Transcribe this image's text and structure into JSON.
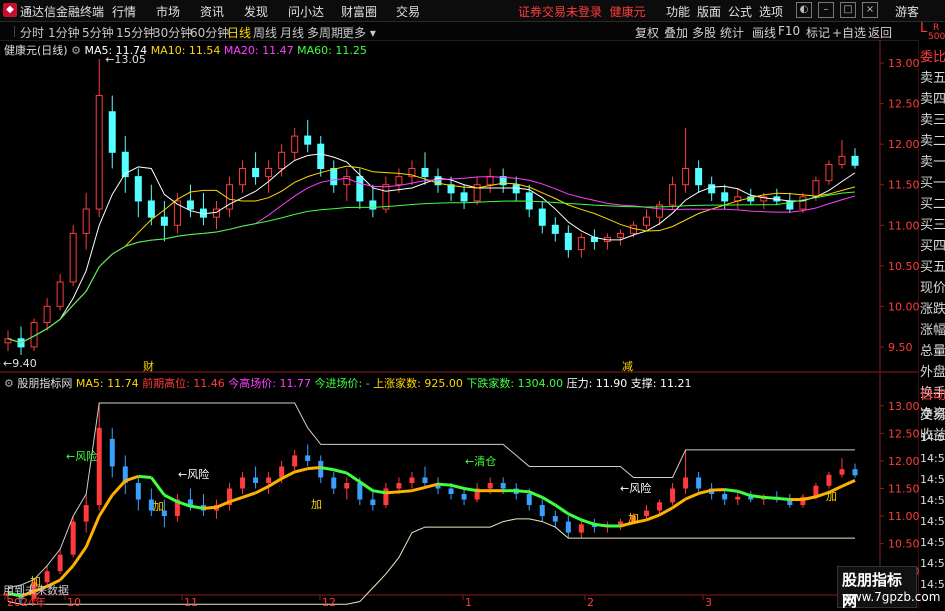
{
  "titlebar": {
    "app_name": "通达信金融终端",
    "menu": [
      "行情",
      "市场",
      "资讯",
      "发现",
      "问小达",
      "财富圈",
      "交易"
    ],
    "notice": "证券交易未登录",
    "stock_name": "健康元",
    "right_menu": [
      "功能",
      "版面",
      "公式",
      "选项"
    ],
    "guest": "游客"
  },
  "toolbar": {
    "periods": [
      "分时",
      "1分钟",
      "5分钟",
      "15分钟",
      "30分钟",
      "60分钟",
      "日线",
      "周线",
      "月线",
      "多周期",
      "更多"
    ],
    "active_period": "日线",
    "right_tools": [
      "复权",
      "叠加",
      "多股",
      "统计",
      "画线",
      "F10",
      "标记",
      "+自选",
      "返回"
    ]
  },
  "sidebar": {
    "lr_top": "L",
    "lr_r": "R",
    "lr_num": "500",
    "items": [
      "委比",
      "卖五",
      "卖四",
      "卖三",
      "卖二",
      "卖一",
      "买一",
      "买二",
      "买三",
      "买四",
      "买五",
      "现价",
      "涨跌",
      "涨幅",
      "总量",
      "外盘",
      "换手",
      "净资",
      "收益"
    ],
    "lower_items": [
      "自动",
      "交易"
    ],
    "times": [
      "14:56",
      "14:56",
      "14:56",
      "14:56",
      "14:56",
      "14:56",
      "14:56",
      "14:56"
    ]
  },
  "main_panel": {
    "title": "健康元(日线)",
    "ma": [
      {
        "label": "MA5: 11.74",
        "color": "#ffffff"
      },
      {
        "label": "MA10: 11.54",
        "color": "#ffd700"
      },
      {
        "label": "MA20: 11.47",
        "color": "#ff40ff"
      },
      {
        "label": "MA60: 11.25",
        "color": "#40ff40"
      }
    ],
    "y_ticks": [
      "13.00",
      "12.50",
      "12.00",
      "11.50",
      "11.00",
      "10.50",
      "10.00",
      "9.50"
    ],
    "high_label": "13.05",
    "low_label": "9.40",
    "markers": [
      "财",
      "减"
    ]
  },
  "sub_panel": {
    "title": "股朋指标网",
    "fields": [
      {
        "label": "MA5: 11.74",
        "color": "#ffd700"
      },
      {
        "label": "前期高位: 11.46",
        "color": "#ff3b3b"
      },
      {
        "label": "今高场价: 11.77",
        "color": "#ff40ff"
      },
      {
        "label": "今进场价: -",
        "color": "#40ff40"
      },
      {
        "label": "上涨家数: 925.00",
        "color": "#ffd700"
      },
      {
        "label": "下跌家数: 1304.00",
        "color": "#40ff40"
      },
      {
        "label": "压力: 11.90",
        "color": "#ffffff"
      },
      {
        "label": "支撑: 11.21",
        "color": "#ffffff"
      }
    ],
    "y_ticks": [
      "13.00",
      "12.50",
      "12.00",
      "11.50",
      "11.00",
      "10.50",
      "10.00"
    ],
    "annotations": [
      "风险",
      "风险",
      "清仓",
      "风险",
      "加",
      "加",
      "加",
      "加",
      "加"
    ],
    "footer": "用到未来数据"
  },
  "x_ticks": [
    "2024年",
    "10",
    "11",
    "12",
    "1",
    "2",
    "3"
  ],
  "watermark": {
    "line1": "股朋指标网",
    "line2": "www.7gpzb.com"
  },
  "chart_data": {
    "type": "candlestick",
    "title": "健康元(日线)",
    "x_ticks": [
      "2024年",
      "10",
      "11",
      "12",
      "1",
      "2",
      "3"
    ],
    "ylim": [
      9.3,
      13.3
    ],
    "candles_ohlc": [
      [
        9.55,
        9.7,
        9.45,
        9.6
      ],
      [
        9.6,
        9.75,
        9.4,
        9.5
      ],
      [
        9.5,
        9.85,
        9.45,
        9.8
      ],
      [
        9.8,
        10.1,
        9.7,
        10.0
      ],
      [
        10.0,
        10.4,
        9.95,
        10.3
      ],
      [
        10.3,
        11.0,
        10.25,
        10.9
      ],
      [
        10.9,
        11.4,
        10.7,
        11.2
      ],
      [
        11.2,
        13.05,
        11.1,
        12.6
      ],
      [
        12.4,
        12.6,
        11.7,
        11.9
      ],
      [
        11.9,
        12.1,
        11.4,
        11.6
      ],
      [
        11.6,
        11.7,
        11.1,
        11.3
      ],
      [
        11.3,
        11.5,
        11.0,
        11.1
      ],
      [
        11.1,
        11.3,
        10.8,
        11.0
      ],
      [
        11.0,
        11.4,
        10.9,
        11.3
      ],
      [
        11.3,
        11.5,
        11.1,
        11.2
      ],
      [
        11.2,
        11.4,
        11.0,
        11.1
      ],
      [
        11.1,
        11.3,
        10.95,
        11.2
      ],
      [
        11.2,
        11.6,
        11.1,
        11.5
      ],
      [
        11.5,
        11.8,
        11.4,
        11.7
      ],
      [
        11.7,
        11.9,
        11.5,
        11.6
      ],
      [
        11.6,
        11.8,
        11.4,
        11.7
      ],
      [
        11.7,
        12.0,
        11.6,
        11.9
      ],
      [
        11.9,
        12.2,
        11.8,
        12.1
      ],
      [
        12.1,
        12.3,
        11.9,
        12.0
      ],
      [
        12.0,
        12.1,
        11.6,
        11.7
      ],
      [
        11.7,
        11.8,
        11.4,
        11.5
      ],
      [
        11.5,
        11.7,
        11.3,
        11.6
      ],
      [
        11.6,
        11.7,
        11.2,
        11.3
      ],
      [
        11.3,
        11.5,
        11.1,
        11.2
      ],
      [
        11.2,
        11.6,
        11.15,
        11.5
      ],
      [
        11.5,
        11.7,
        11.4,
        11.6
      ],
      [
        11.6,
        11.8,
        11.5,
        11.7
      ],
      [
        11.7,
        11.9,
        11.5,
        11.6
      ],
      [
        11.6,
        11.7,
        11.4,
        11.5
      ],
      [
        11.5,
        11.6,
        11.3,
        11.4
      ],
      [
        11.4,
        11.5,
        11.2,
        11.3
      ],
      [
        11.3,
        11.6,
        11.25,
        11.5
      ],
      [
        11.5,
        11.7,
        11.4,
        11.6
      ],
      [
        11.6,
        11.7,
        11.4,
        11.5
      ],
      [
        11.5,
        11.6,
        11.3,
        11.4
      ],
      [
        11.4,
        11.5,
        11.1,
        11.2
      ],
      [
        11.2,
        11.3,
        10.9,
        11.0
      ],
      [
        11.0,
        11.1,
        10.8,
        10.9
      ],
      [
        10.9,
        11.0,
        10.6,
        10.7
      ],
      [
        10.7,
        10.9,
        10.6,
        10.85
      ],
      [
        10.85,
        10.95,
        10.7,
        10.8
      ],
      [
        10.8,
        10.9,
        10.7,
        10.85
      ],
      [
        10.85,
        10.95,
        10.75,
        10.9
      ],
      [
        10.9,
        11.05,
        10.85,
        11.0
      ],
      [
        11.0,
        11.2,
        10.95,
        11.1
      ],
      [
        11.1,
        11.3,
        11.0,
        11.25
      ],
      [
        11.25,
        11.6,
        11.2,
        11.5
      ],
      [
        11.5,
        12.2,
        11.4,
        11.7
      ],
      [
        11.7,
        11.8,
        11.4,
        11.5
      ],
      [
        11.5,
        11.6,
        11.3,
        11.4
      ],
      [
        11.4,
        11.5,
        11.2,
        11.3
      ],
      [
        11.3,
        11.45,
        11.2,
        11.35
      ],
      [
        11.35,
        11.45,
        11.25,
        11.3
      ],
      [
        11.3,
        11.4,
        11.2,
        11.35
      ],
      [
        11.35,
        11.45,
        11.25,
        11.3
      ],
      [
        11.3,
        11.4,
        11.15,
        11.2
      ],
      [
        11.2,
        11.4,
        11.15,
        11.35
      ],
      [
        11.35,
        11.6,
        11.3,
        11.55
      ],
      [
        11.55,
        11.8,
        11.5,
        11.75
      ],
      [
        11.75,
        12.05,
        11.7,
        11.85
      ],
      [
        11.85,
        11.95,
        11.7,
        11.74
      ]
    ]
  }
}
